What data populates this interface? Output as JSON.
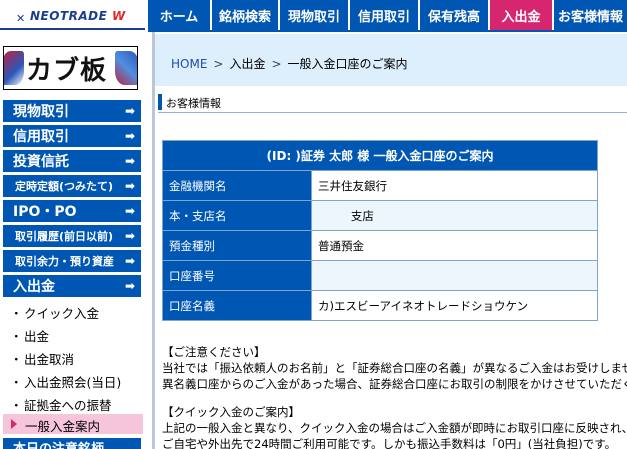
{
  "header": {
    "logo_text": "NEOTRADE",
    "logo_mark": "W",
    "nav": [
      {
        "label": "ホーム",
        "active": false
      },
      {
        "label": "銘柄検索",
        "active": false
      },
      {
        "label": "現物取引",
        "active": false
      },
      {
        "label": "信用取引",
        "active": false
      },
      {
        "label": "保有残高",
        "active": false
      },
      {
        "label": "入出金",
        "active": true
      },
      {
        "label": "お客様情報",
        "active": false
      }
    ]
  },
  "sidebar": {
    "brand": "カブ板",
    "menu": {
      "genbutsu": "現物取引",
      "shinyo": "信用取引",
      "toushin": "投資信託",
      "teiji": "定時定額(つみたて)",
      "ipo": "IPO・PO",
      "rireki": "取引履歴(前日以前)",
      "yoryoku": "取引余力・預り資産",
      "nyushukkin": "入出金"
    },
    "arrow": "➡",
    "dot": "・",
    "sub_items": [
      "クイック入金",
      "出金",
      "出金取消",
      "入出金照会(当日)",
      "証拠金への振替"
    ],
    "active_sub": "一般入金案内",
    "bottom_cut": "本日の注意銘柄"
  },
  "main": {
    "breadcrumb": {
      "home": "HOME",
      "sep": ">",
      "level1": "入出金",
      "level2": "一般入金口座のご案内"
    },
    "section_title": "お客様情報",
    "table": {
      "header": "(ID:                )証券  太郎  様  一般入金口座のご案内",
      "rows": [
        {
          "label": "金融機関名",
          "value": "三井住友銀行"
        },
        {
          "label": "本・支店名",
          "value": "         支店"
        },
        {
          "label": "預金種別",
          "value": "普通預金"
        },
        {
          "label": "口座番号",
          "value": ""
        },
        {
          "label": "口座名義",
          "value": "カ)エスビーアイネオトレードショウケン"
        }
      ]
    },
    "notes": [
      {
        "title": "【ご注意ください】",
        "lines": [
          "当社では「振込依頼人のお名前」と「証券総合口座の名義」が異なるご入金はお受けしません",
          "異名義口座からのご入金があった場合、証券総合口座にお取引の制限をかけさせていただく"
        ]
      },
      {
        "title": "【クイック入金のご案内】",
        "lines": [
          "上記の一般入金と異なり、クイック入金の場合はご入金額が即時にお取引口座に反映され、",
          "ご自宅や外出先で24時間ご利用可能です。しかも振込手数料は「0円」(当社負担)です。"
        ]
      }
    ]
  }
}
